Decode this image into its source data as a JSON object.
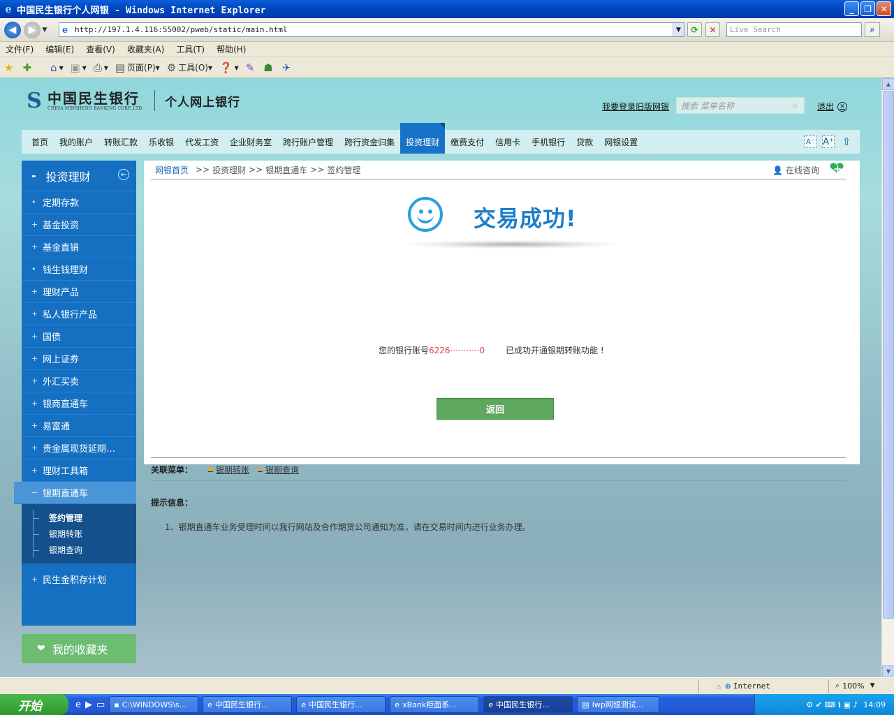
{
  "window": {
    "title": "中国民生银行个人网银 - Windows Internet Explorer",
    "url": "http://197.1.4.116:55002/pweb/static/main.html",
    "search_placeholder": "Live Search"
  },
  "menubar": [
    "文件(F)",
    "编辑(E)",
    "查看(V)",
    "收藏夹(A)",
    "工具(T)",
    "帮助(H)"
  ],
  "toolbar": {
    "page": "页面(P)",
    "tools": "工具(O)"
  },
  "bank": {
    "name_cn": "中国民生银行",
    "name_en": "CHINA MINSHENG BANKING CORP.,LTD.",
    "product": "个人网上银行",
    "old_login": "我要登录旧版网银",
    "search_placeholder": "搜索 菜单名称",
    "logout": "退出"
  },
  "mainnav": {
    "items": [
      "首页",
      "我的账户",
      "转账汇款",
      "乐收银",
      "代发工资",
      "企业财务室",
      "跨行账户管理",
      "跨行资金归集",
      "投资理财",
      "缴费支付",
      "信用卡",
      "手机银行",
      "贷款",
      "网银设置"
    ],
    "active_index": 8,
    "tool_font_small": "A",
    "tool_font_large": "A"
  },
  "sidebar": {
    "title": "投资理财",
    "items": [
      {
        "bullet": "•",
        "label": "定期存款"
      },
      {
        "bullet": "+",
        "label": "基金投资"
      },
      {
        "bullet": "+",
        "label": "基金直销"
      },
      {
        "bullet": "•",
        "label": "钱生钱理财"
      },
      {
        "bullet": "+",
        "label": "理财产品"
      },
      {
        "bullet": "+",
        "label": "私人银行产品"
      },
      {
        "bullet": "+",
        "label": "国债"
      },
      {
        "bullet": "+",
        "label": "网上证券"
      },
      {
        "bullet": "+",
        "label": "外汇买卖"
      },
      {
        "bullet": "+",
        "label": "银商直通车"
      },
      {
        "bullet": "+",
        "label": "易富通"
      },
      {
        "bullet": "+",
        "label": "贵金属现货延期…"
      },
      {
        "bullet": "+",
        "label": "理财工具箱"
      }
    ],
    "active": {
      "bullet": "−",
      "label": "银期直通车"
    },
    "sub": [
      "签约管理",
      "银期转账",
      "银期查询"
    ],
    "after": {
      "bullet": "+",
      "label": "民生金积存计划"
    },
    "favorites": "我的收藏夹"
  },
  "content": {
    "breadcrumb": [
      "网银首页",
      "投资理财",
      "银期直通车",
      "签约管理"
    ],
    "crumb_sep": ">>",
    "consult": "在线咨询",
    "success_title": "交易成功!",
    "message_prefix": "您的银行账号",
    "message_account": "6226···········0",
    "message_suffix": "已成功开通银期转账功能 !",
    "return_button": "返回",
    "related_label": "关联菜单：",
    "related": [
      "银期转账",
      "银期查询"
    ],
    "tips_label": "提示信息：",
    "tip_1": "1、银期直通车业务受理时间以我行网站及合作期货公司通知为准，请在交易时间内进行业务办理。"
  },
  "statusbar": {
    "zone": "Internet",
    "zoom": "100%"
  },
  "taskbar": {
    "start": "开始",
    "tasks": [
      "C:\\WINDOWS\\s...",
      "中国民生银行...",
      "中国民生银行...",
      "xBank柜面系...",
      "中国民生银行...",
      "lwp网银测试..."
    ],
    "active_task_index": 4,
    "clock": "14:09"
  },
  "colors": {
    "nav_active": "#1873c8",
    "sidebar": "#1570c2",
    "success": "#1d7ec9",
    "return_button": "#5ea85e"
  }
}
